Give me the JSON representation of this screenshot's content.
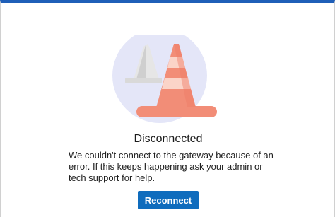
{
  "dialog": {
    "title": "Disconnected",
    "message": "We couldn't connect to the gateway because of an error. If this keeps happening ask your admin or tech support for help.",
    "reconnect_label": "Reconnect",
    "illustration_icon": "traffic-cone-icon"
  },
  "colors": {
    "accent_top_bar": "#1f5fb8",
    "button_bg": "#0f6cbd",
    "illustration_circle": "#e4e6f8",
    "cone_front": "#f28d77",
    "cone_front_stripe": "#fbd4c8",
    "cone_back": "#d7d7d7"
  }
}
